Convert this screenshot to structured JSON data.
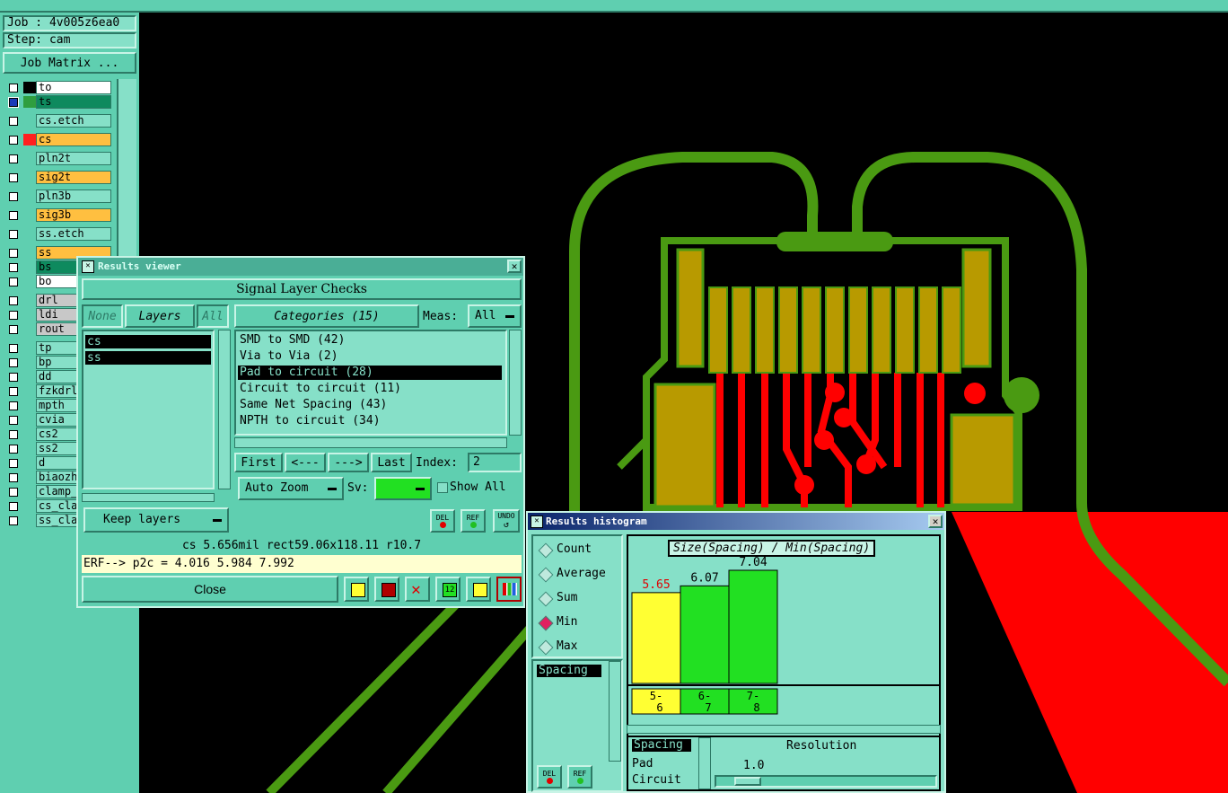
{
  "job": {
    "job_label": "Job : 4v005z6ea0",
    "step_label": "Step: cam",
    "matrix_button": "Job Matrix ..."
  },
  "layers": [
    {
      "name": "to",
      "color": "#ffffff",
      "swatch": "#000000"
    },
    {
      "name": "ts",
      "color": "#0e8a5e",
      "swatch": "#2f9e3f",
      "sel": true
    },
    {
      "name": "cs.etch",
      "color": "#86e0c8",
      "swatch": ""
    },
    {
      "name": "cs",
      "color": "#ffbf40",
      "swatch": "#ff2020"
    },
    {
      "name": "pln2t",
      "color": "#86e0c8",
      "swatch": ""
    },
    {
      "name": "sig2t",
      "color": "#ffbf40",
      "swatch": ""
    },
    {
      "name": "pln3b",
      "color": "#86e0c8",
      "swatch": ""
    },
    {
      "name": "sig3b",
      "color": "#ffbf40",
      "swatch": ""
    },
    {
      "name": "ss.etch",
      "color": "#86e0c8",
      "swatch": ""
    },
    {
      "name": "ss",
      "color": "#ffbf40",
      "swatch": ""
    },
    {
      "name": "bs",
      "color": "#0e8a5e",
      "swatch": ""
    },
    {
      "name": "bo",
      "color": "#ffffff",
      "swatch": ""
    },
    {
      "name": "drl",
      "color": "#c8c8c8",
      "swatch": ""
    },
    {
      "name": "ldi",
      "color": "#c8c8c8",
      "swatch": ""
    },
    {
      "name": "rout",
      "color": "#c8c8c8",
      "swatch": ""
    },
    {
      "name": "tp",
      "color": "#86e0c8",
      "swatch": ""
    },
    {
      "name": "bp",
      "color": "#86e0c8",
      "swatch": ""
    },
    {
      "name": "dd",
      "color": "#86e0c8",
      "swatch": ""
    },
    {
      "name": "fzkdrl",
      "color": "#86e0c8",
      "swatch": ""
    },
    {
      "name": "mpth",
      "color": "#86e0c8",
      "swatch": ""
    },
    {
      "name": "cvia",
      "color": "#86e0c8",
      "swatch": ""
    },
    {
      "name": "cs2",
      "color": "#86e0c8",
      "swatch": ""
    },
    {
      "name": "ss2",
      "color": "#86e0c8",
      "swatch": ""
    },
    {
      "name": "d",
      "color": "#86e0c8",
      "swatch": ""
    },
    {
      "name": "biaozh",
      "color": "#86e0c8",
      "swatch": ""
    },
    {
      "name": "clamp_",
      "color": "#86e0c8",
      "swatch": ""
    },
    {
      "name": "cs_cla",
      "color": "#86e0c8",
      "swatch": ""
    },
    {
      "name": "ss_cla",
      "color": "#86e0c8",
      "swatch": ""
    }
  ],
  "results_viewer": {
    "title": "Results viewer",
    "header": "Signal Layer Checks",
    "none_btn": "None",
    "layers_btn": "Layers",
    "all_btn": "All",
    "categories_btn": "Categories (15)",
    "meas_label": "Meas:",
    "meas_value": "All",
    "layer_list": [
      "cs",
      "ss"
    ],
    "categories": [
      {
        "label": "SMD to SMD (42)",
        "selected": false
      },
      {
        "label": "Via to Via (2)",
        "selected": false
      },
      {
        "label": "Pad to circuit (28)",
        "selected": true
      },
      {
        "label": "Circuit to circuit (11)",
        "selected": false
      },
      {
        "label": "Same Net Spacing (43)",
        "selected": false
      },
      {
        "label": "NPTH to circuit (34)",
        "selected": false
      }
    ],
    "first": "First",
    "prev": "<---",
    "next": "--->",
    "last": "Last",
    "index_label": "Index:",
    "index_value": "2",
    "auto_zoom": "Auto Zoom",
    "sv_label": "Sv:",
    "show_all": "Show All",
    "keep_layers": "Keep layers",
    "del": "DEL",
    "ref": "REF",
    "undo": "UNDO",
    "status1": "cs  5.656mil  rect59.06x118.11  r10.7",
    "status2": "ERF--> p2c = 4.016 5.984 7.992",
    "close": "Close"
  },
  "histogram": {
    "title": "Results histogram",
    "options": [
      {
        "label": "Count",
        "on": false
      },
      {
        "label": "Average",
        "on": false
      },
      {
        "label": "Sum",
        "on": false
      },
      {
        "label": "Min",
        "on": true
      },
      {
        "label": "Max",
        "on": false
      }
    ],
    "list": [
      "Spacing"
    ],
    "chart_title": "Size(Spacing) / Min(Spacing)",
    "del": "DEL",
    "ref": "REF",
    "res_list": [
      "Spacing",
      "Pad",
      "Circuit"
    ],
    "resolution_label": "Resolution",
    "resolution_value": "1.0"
  },
  "chart_data": {
    "type": "bar",
    "title": "Size(Spacing) / Min(Spacing)",
    "categories": [
      "5-6",
      "6-7",
      "7-8"
    ],
    "values": [
      5.65,
      6.07,
      7.04
    ],
    "value_labels": [
      "5.65",
      "6.07",
      "7.04"
    ],
    "colors": [
      "#ffff33",
      "#22e022",
      "#22e022"
    ],
    "label_colors": [
      "#e00000",
      "#000000",
      "#000000"
    ]
  },
  "colors": {
    "panel": "#5fcfb0",
    "panel_light": "#86e0c8",
    "pcb_green": "#4a9a12",
    "pcb_pad": "#b89a00",
    "pcb_trace": "#ff0000"
  }
}
